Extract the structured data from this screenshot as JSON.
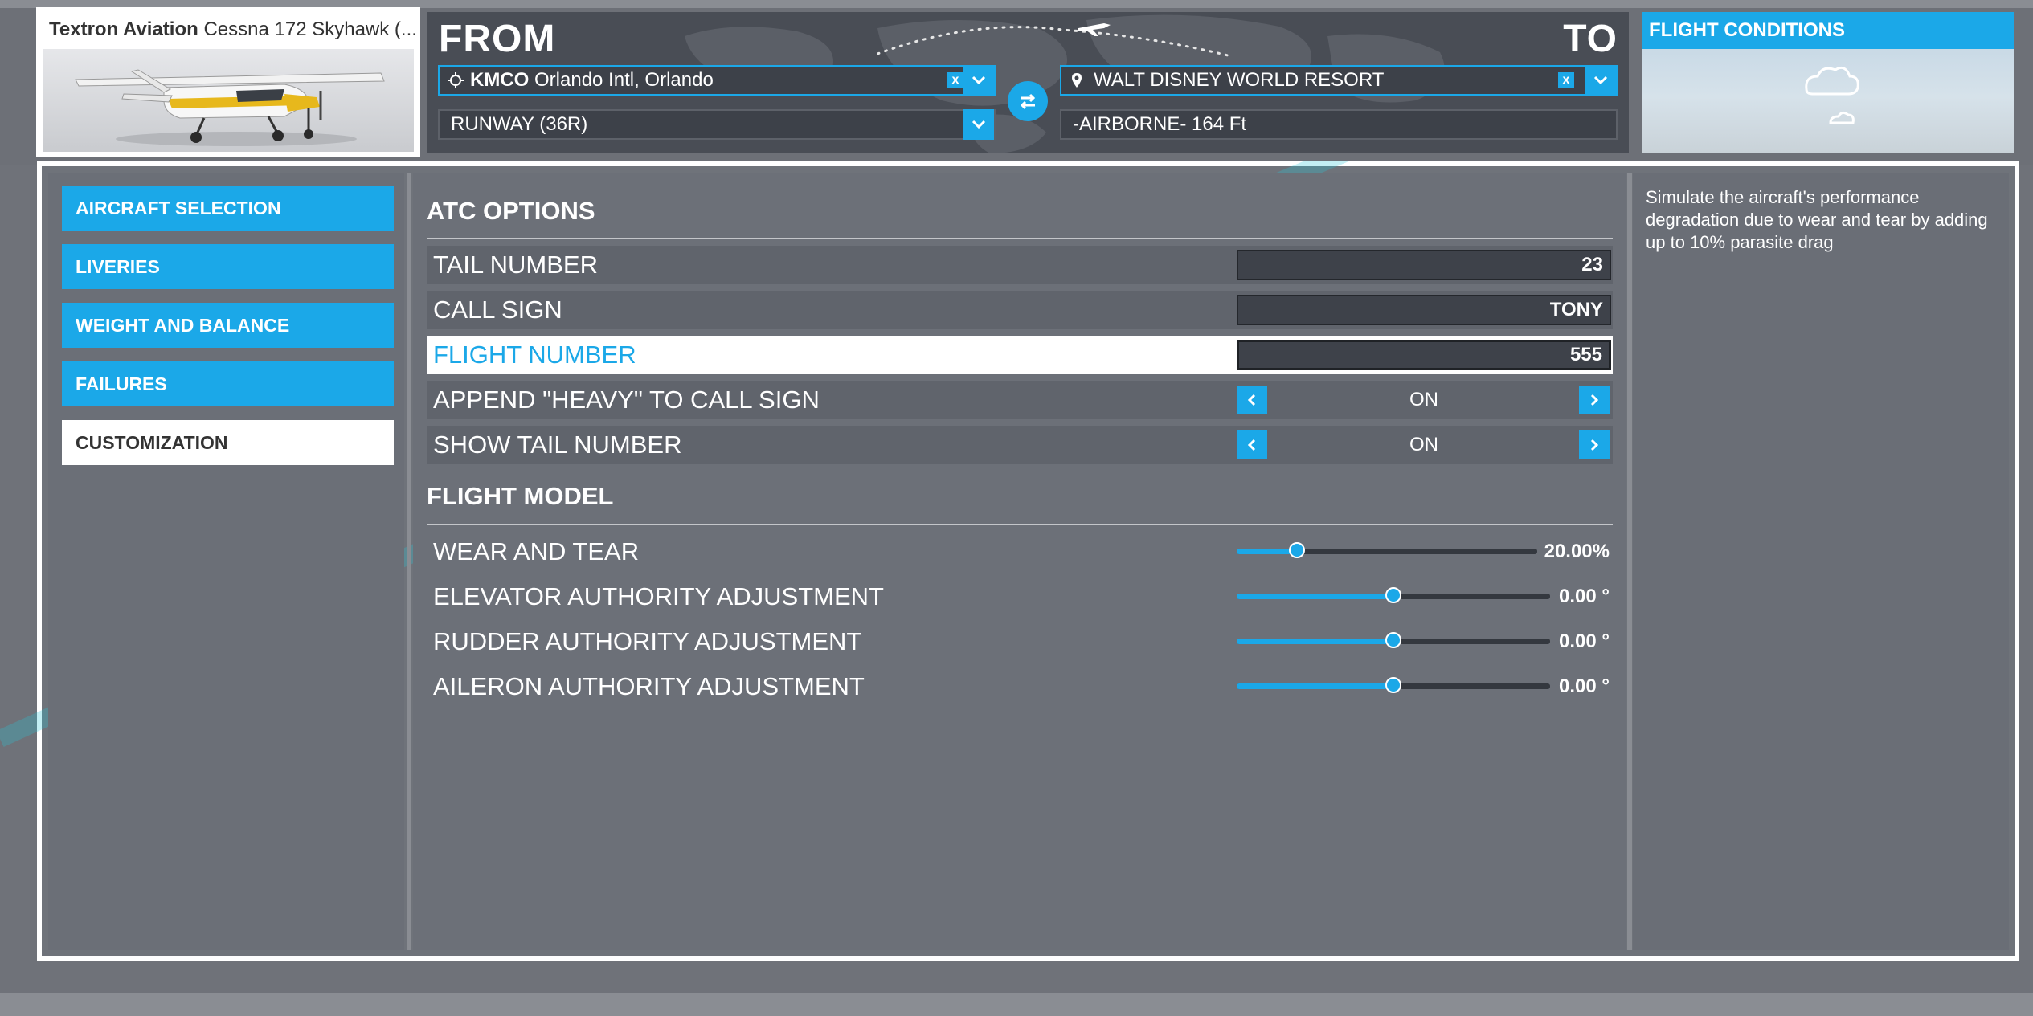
{
  "aircraft": {
    "manufacturer": "Textron Aviation",
    "model": "Cessna 172 Skyhawk (..."
  },
  "route": {
    "from_label": "FROM",
    "to_label": "TO",
    "departure_code": "KMCO",
    "departure_name": "Orlando Intl, Orlando",
    "runway": "RUNWAY (36R)",
    "destination": "WALT DISNEY WORLD RESORT",
    "arrival_mode": "-AIRBORNE- 164 Ft",
    "clear_glyph": "x"
  },
  "flight_conditions": {
    "label": "FLIGHT CONDITIONS",
    "icon": "cloud-icon"
  },
  "sidebar": {
    "items": [
      {
        "label": "AIRCRAFT SELECTION"
      },
      {
        "label": "LIVERIES"
      },
      {
        "label": "WEIGHT AND BALANCE"
      },
      {
        "label": "FAILURES"
      },
      {
        "label": "CUSTOMIZATION"
      }
    ],
    "active_index": 4
  },
  "atc": {
    "title": "ATC OPTIONS",
    "tail_number": {
      "label": "TAIL NUMBER",
      "value": "23"
    },
    "call_sign": {
      "label": "CALL SIGN",
      "value": "TONY"
    },
    "flight_number": {
      "label": "FLIGHT NUMBER",
      "value": "555"
    },
    "append_heavy": {
      "label": "APPEND \"HEAVY\" TO CALL SIGN",
      "value": "ON"
    },
    "show_tail": {
      "label": "SHOW TAIL NUMBER",
      "value": "ON"
    }
  },
  "flight_model": {
    "title": "FLIGHT MODEL",
    "wear_and_tear": {
      "label": "WEAR AND TEAR",
      "value": "20.00%",
      "fraction": 0.2
    },
    "elevator": {
      "label": "ELEVATOR AUTHORITY ADJUSTMENT",
      "value": "0.00 °",
      "fraction": 0.5
    },
    "rudder": {
      "label": "RUDDER AUTHORITY ADJUSTMENT",
      "value": "0.00 °",
      "fraction": 0.5
    },
    "aileron": {
      "label": "AILERON AUTHORITY ADJUSTMENT",
      "value": "0.00 °",
      "fraction": 0.5
    }
  },
  "description": {
    "text": "Simulate the aircraft's performance degradation due to wear and tear by adding up to 10% parasite drag"
  },
  "colors": {
    "accent": "#1ba8e8",
    "panel": "#494d55",
    "background": "#6f7279"
  }
}
